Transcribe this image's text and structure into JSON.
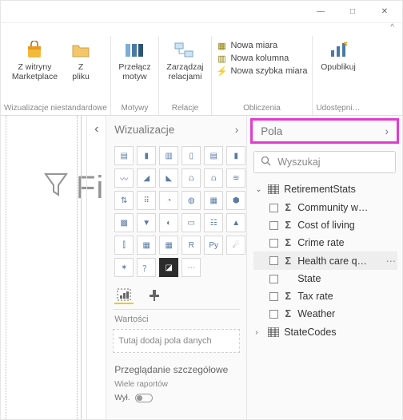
{
  "window": {
    "minimize": "—",
    "maximize": "□",
    "close": "✕",
    "caret": "^"
  },
  "ribbon": {
    "group_custom_viz": {
      "marketplace": "Z witryny\nMarketplace",
      "from_file": "Z\npliku",
      "caption": "Wizualizacje niestandardowe"
    },
    "group_themes": {
      "switch_theme": "Przełącz\nmotyw",
      "caption": "Motywy"
    },
    "group_relations": {
      "manage": "Zarządzaj\nrelacjami",
      "caption": "Relacje"
    },
    "group_calc": {
      "new_measure": "Nowa miara",
      "new_column": "Nowa kolumna",
      "quick_measure": "Nowa szybka miara",
      "caption": "Obliczenia"
    },
    "group_publish": {
      "publish": "Opublikuj",
      "caption": "Udostępni…"
    }
  },
  "watermark": "Filtry",
  "panels": {
    "viz_title": "Wizualizacje",
    "fields_title": "Pola",
    "values_header": "Wartości",
    "values_placeholder": "Tutaj dodaj pola danych",
    "drill_header": "Przeglądanie szczegółowe",
    "drill_sub": "Wiele raportów",
    "drill_toggle": "Wył."
  },
  "search": {
    "placeholder": "Wyszukaj"
  },
  "viz_types": [
    "stacked-bar",
    "stacked-column",
    "clustered-bar",
    "clustered-column",
    "100-bar",
    "100-column",
    "line",
    "area",
    "stacked-area",
    "line-stacked",
    "line-clustered",
    "ribbon",
    "waterfall",
    "scatter",
    "pie",
    "donut",
    "treemap",
    "map",
    "filled-map",
    "funnel",
    "gauge",
    "card",
    "multi-card",
    "kpi",
    "slicer",
    "table",
    "matrix",
    "r-visual",
    "py-visual",
    "key-influencers",
    "decomp",
    "qna",
    "custom",
    "more"
  ],
  "viz_glyph": [
    "▤",
    "▮",
    "▥",
    "▯",
    "▤",
    "▮",
    "〰",
    "◢",
    "◣",
    "⩍",
    "⩍",
    "≋",
    "⇅",
    "⠿",
    "◔",
    "◍",
    "▦",
    "⬢",
    "▩",
    "▼",
    "◐",
    "▭",
    "☷",
    "▲",
    "⫿",
    "▦",
    "▦",
    "R",
    "Py",
    "☄",
    "✶",
    "？",
    "◪",
    "⋯"
  ],
  "tables": [
    {
      "name": "RetirementStats",
      "expanded": true,
      "fields": [
        {
          "label": "Community w…",
          "sigma": true,
          "selected": false
        },
        {
          "label": "Cost of living",
          "sigma": true,
          "selected": false
        },
        {
          "label": "Crime rate",
          "sigma": true,
          "selected": false
        },
        {
          "label": "Health care q…",
          "sigma": true,
          "selected": true,
          "more": true
        },
        {
          "label": "State",
          "sigma": false,
          "selected": false
        },
        {
          "label": "Tax rate",
          "sigma": true,
          "selected": false
        },
        {
          "label": "Weather",
          "sigma": true,
          "selected": false
        }
      ]
    },
    {
      "name": "StateCodes",
      "expanded": false,
      "fields": []
    }
  ]
}
